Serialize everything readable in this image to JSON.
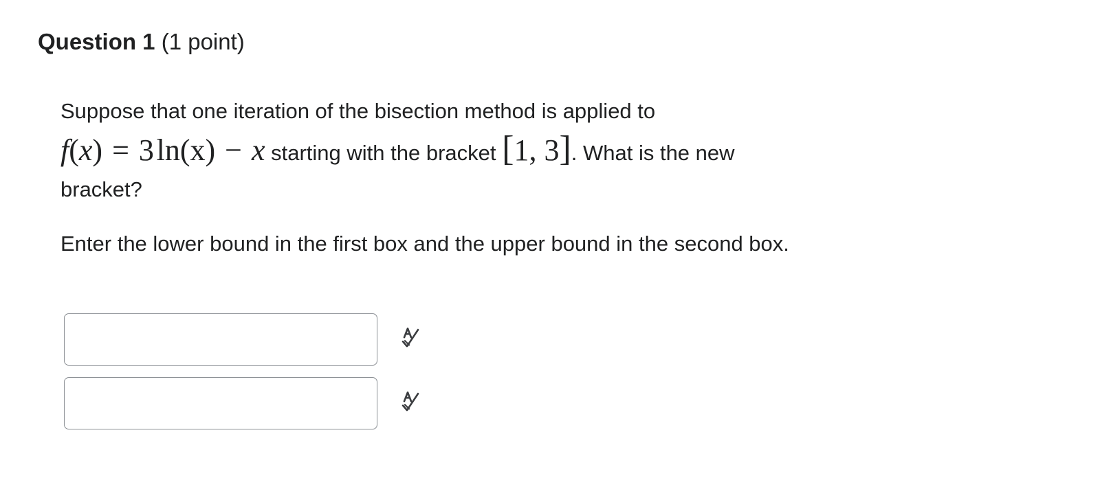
{
  "question": {
    "title": "Question 1",
    "points": "(1 point)"
  },
  "prompt": {
    "line1": "Suppose that one iteration of the bisection method is applied to",
    "math_f": "f",
    "math_paren_open": "(",
    "math_x1": "x",
    "math_paren_close": ")",
    "math_eq": "=",
    "math_coef": "3",
    "math_ln": "ln",
    "math_arg": "(x)",
    "math_minus": "−",
    "math_x2": "x",
    "text_mid": " starting with the bracket ",
    "bracket_open": "[",
    "bracket_values": "1, 3",
    "bracket_close": "]",
    "text_end": ". What is the new",
    "line3": "bracket?"
  },
  "instruction": "Enter the lower bound in the first box and the upper bound in the second box.",
  "answers": [
    {
      "value": "",
      "icon": "spell-check-icon"
    },
    {
      "value": "",
      "icon": "spell-check-icon"
    }
  ]
}
